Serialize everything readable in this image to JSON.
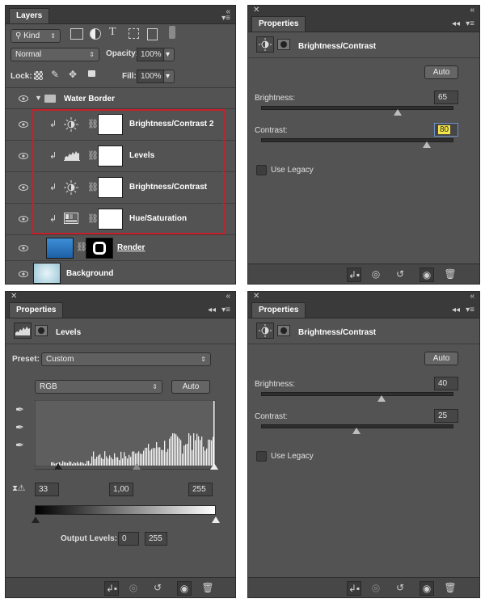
{
  "layers_panel": {
    "tab": "Layers",
    "filter_kind": "Kind",
    "blend_mode": "Normal",
    "opacity_label": "Opacity:",
    "opacity_value": "100%",
    "lock_label": "Lock:",
    "fill_label": "Fill:",
    "fill_value": "100%",
    "group_name": "Water Border",
    "layers": [
      {
        "name": "Brightness/Contrast 2",
        "icon": "brightness-contrast-icon"
      },
      {
        "name": "Levels",
        "icon": "levels-icon"
      },
      {
        "name": "Brightness/Contrast",
        "icon": "brightness-contrast-icon"
      },
      {
        "name": "Hue/Saturation",
        "icon": "hue-saturation-icon"
      },
      {
        "name": "Render",
        "icon": "image-thumbnail"
      },
      {
        "name": "Background",
        "icon": "image-thumbnail"
      }
    ],
    "selection_color": "#c8202a"
  },
  "props_bc_top": {
    "tab": "Properties",
    "adjustment": "Brightness/Contrast",
    "auto": "Auto",
    "brightness_label": "Brightness:",
    "brightness_value": "65",
    "brightness": 65,
    "contrast_label": "Contrast:",
    "contrast_value": "80",
    "contrast": 80,
    "legacy_label": "Use Legacy"
  },
  "props_levels": {
    "tab": "Properties",
    "adjustment": "Levels",
    "preset_label": "Preset:",
    "preset_value": "Custom",
    "channel": "RGB",
    "auto": "Auto",
    "input_black": "33",
    "input_gamma": "1,00",
    "input_white": "255",
    "output_label": "Output Levels:",
    "output_black": "0",
    "output_white": "255"
  },
  "props_bc_bottom": {
    "tab": "Properties",
    "adjustment": "Brightness/Contrast",
    "auto": "Auto",
    "brightness_label": "Brightness:",
    "brightness_value": "40",
    "brightness": 40,
    "contrast_label": "Contrast:",
    "contrast_value": "25",
    "contrast": 25,
    "legacy_label": "Use Legacy"
  }
}
